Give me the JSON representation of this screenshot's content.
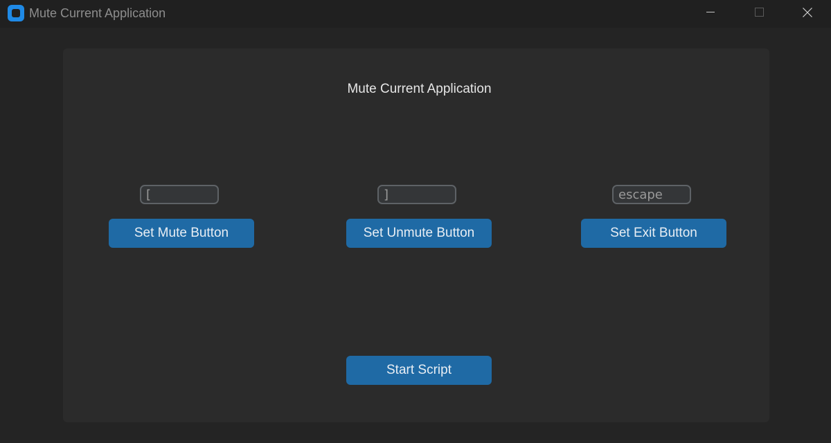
{
  "window": {
    "title": "Mute Current Application"
  },
  "panel": {
    "heading": "Mute Current Application"
  },
  "hotkeys": {
    "mute": {
      "value": "[",
      "button_label": "Set Mute Button"
    },
    "unmute": {
      "value": "]",
      "button_label": "Set Unmute Button"
    },
    "exit": {
      "value": "escape",
      "button_label": "Set Exit Button"
    }
  },
  "start_button_label": "Start Script",
  "colors": {
    "background": "#242424",
    "panel": "#2b2b2b",
    "button": "#1f6aa5",
    "entry_border": "#5e6266",
    "app_icon": "#1f8ae6"
  }
}
